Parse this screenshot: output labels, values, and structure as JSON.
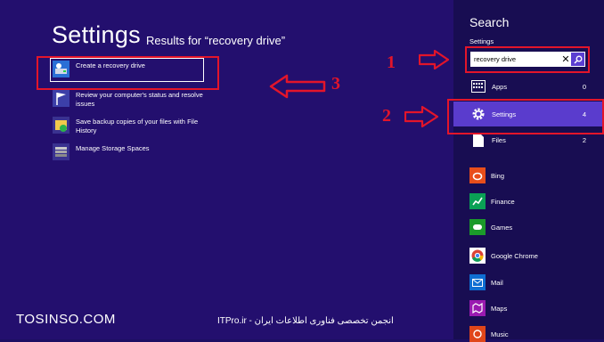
{
  "main": {
    "title": "Settings",
    "subtitle": "Results for “recovery drive”",
    "results": [
      {
        "label": "Create a recovery drive"
      },
      {
        "label": "Review your computer's status and resolve issues"
      },
      {
        "label": "Save backup copies of your files with File History"
      },
      {
        "label": "Manage Storage Spaces"
      }
    ]
  },
  "sidebar": {
    "title": "Search",
    "scope": "Settings",
    "search_value": "recovery drive",
    "categories": [
      {
        "label": "Apps",
        "count": "0"
      },
      {
        "label": "Settings",
        "count": "4"
      },
      {
        "label": "Files",
        "count": "2"
      }
    ],
    "apps": [
      {
        "label": "Bing",
        "icon": "bing-icon",
        "color": "#e94e1b"
      },
      {
        "label": "Finance",
        "icon": "finance-icon",
        "color": "#0aa055"
      },
      {
        "label": "Games",
        "icon": "games-icon",
        "color": "#1b9a2a"
      },
      {
        "label": "Google Chrome",
        "icon": "chrome-icon",
        "color": "#ffffff"
      },
      {
        "label": "Mail",
        "icon": "mail-icon",
        "color": "#0f6ed2"
      },
      {
        "label": "Maps",
        "icon": "maps-icon",
        "color": "#9a1ab0"
      },
      {
        "label": "Music",
        "icon": "music-icon",
        "color": "#e0461a"
      }
    ]
  },
  "annotations": {
    "step1": "1",
    "step2": "2",
    "step3": "3",
    "accent": "#e3152a"
  },
  "watermarks": {
    "left": "TOSINSO.COM",
    "center": "ITPro.ir - انجمن تخصصی فناوری اطلاعات ایران"
  }
}
